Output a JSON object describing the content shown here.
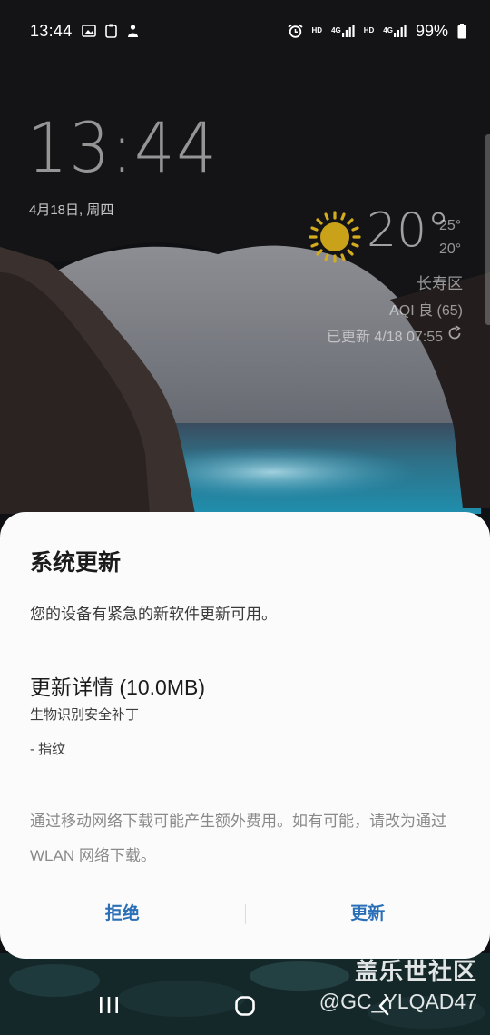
{
  "status_bar": {
    "time": "13:44",
    "left_icons": [
      "gallery-icon",
      "clipboard-icon",
      "smart-assistant-icon"
    ],
    "right_icons": [
      "alarm-icon",
      "volte-hd-icon",
      "signal-4g-icon",
      "volte-hd-icon",
      "signal-4g-icon",
      "battery-icon"
    ],
    "hd_label": "HD",
    "net_label": "4G",
    "battery_percent": "99%"
  },
  "lockscreen": {
    "clock": "13:44",
    "date": "4月18日, 周四"
  },
  "weather": {
    "icon": "sun-icon",
    "temperature": "20°",
    "high": "25°",
    "low": "20°",
    "district": "长寿区",
    "aqi": "AQI 良 (65)",
    "updated": "已更新 4/18 07:55"
  },
  "dialog": {
    "title": "系统更新",
    "message": "您的设备有紧急的新软件更新可用。",
    "details_title": "更新详情 (10.0MB)",
    "details_subtitle": "生物识别安全补丁",
    "details_item": "- 指纹",
    "notice": "通过移动网络下载可能产生额外费用。如有可能，请改为通过 WLAN 网络下载。",
    "decline_label": "拒绝",
    "update_label": "更新",
    "accent_color": "#2a6fb8"
  },
  "navbar": {
    "recents_icon": "recents-icon",
    "home_icon": "home-icon",
    "back_icon": "back-icon"
  },
  "watermark": {
    "title": "盖乐世社区",
    "user": "@GC_YLQAD47"
  }
}
